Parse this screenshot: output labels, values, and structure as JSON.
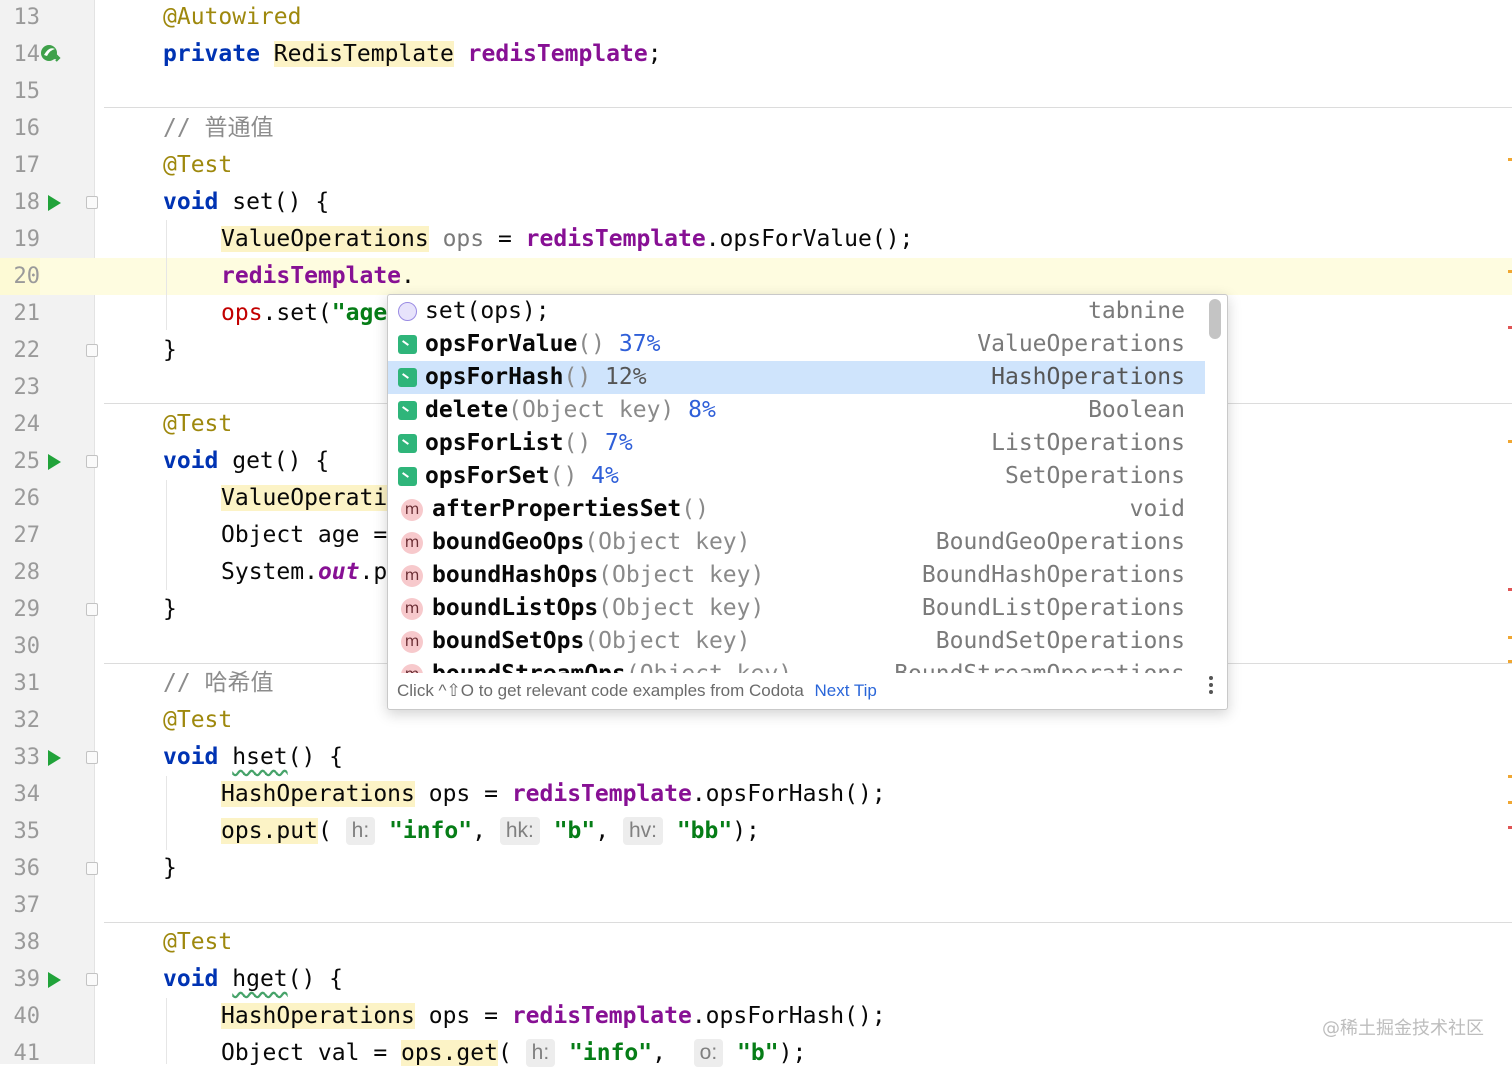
{
  "editor": {
    "lines": [
      {
        "n": "13",
        "gutter": "",
        "parts": [
          [
            "ann",
            "@Autowired"
          ]
        ]
      },
      {
        "n": "14",
        "gutter": "bean",
        "parts": [
          [
            "kw",
            "private"
          ],
          [
            "t",
            " "
          ],
          [
            "hl",
            "RedisTemplate"
          ],
          [
            "t",
            " "
          ],
          [
            "fld",
            "redisTemplate"
          ],
          [
            "t",
            ";"
          ]
        ]
      },
      {
        "n": "15",
        "gutter": "",
        "parts": []
      },
      {
        "n": "16",
        "gutter": "",
        "parts": [
          [
            "cm",
            "// 普通值"
          ]
        ]
      },
      {
        "n": "17",
        "gutter": "",
        "parts": [
          [
            "ann",
            "@Test"
          ]
        ]
      },
      {
        "n": "18",
        "gutter": "run-fold",
        "parts": [
          [
            "kw",
            "void"
          ],
          [
            "t",
            " set() {"
          ]
        ]
      },
      {
        "n": "19",
        "gutter": "",
        "indent": 1,
        "parts": [
          [
            "hl",
            "ValueOperations"
          ],
          [
            "t",
            " "
          ],
          [
            "gray",
            "ops"
          ],
          [
            "t",
            " = "
          ],
          [
            "fld",
            "redisTemplate"
          ],
          [
            "t",
            ".opsForValue();"
          ]
        ]
      },
      {
        "n": "20",
        "gutter": "",
        "indent": 1,
        "current": true,
        "parts": [
          [
            "fld",
            "redisTemplate"
          ],
          [
            "t",
            "."
          ]
        ]
      },
      {
        "n": "21",
        "gutter": "",
        "indent": 1,
        "parts": [
          [
            "red",
            "ops"
          ],
          [
            "t",
            ".set("
          ],
          [
            "str",
            "\"age"
          ]
        ]
      },
      {
        "n": "22",
        "gutter": "fold",
        "parts": [
          [
            "t",
            "}"
          ]
        ]
      },
      {
        "n": "23",
        "gutter": "",
        "parts": []
      },
      {
        "n": "24",
        "gutter": "",
        "parts": [
          [
            "ann",
            "@Test"
          ]
        ]
      },
      {
        "n": "25",
        "gutter": "run-fold",
        "parts": [
          [
            "kw",
            "void"
          ],
          [
            "t",
            " get() {"
          ]
        ]
      },
      {
        "n": "26",
        "gutter": "",
        "indent": 1,
        "parts": [
          [
            "hl",
            "ValueOperati"
          ]
        ]
      },
      {
        "n": "27",
        "gutter": "",
        "indent": 1,
        "parts": [
          [
            "t",
            "Object age ="
          ]
        ]
      },
      {
        "n": "28",
        "gutter": "",
        "indent": 1,
        "parts": [
          [
            "t",
            "System."
          ],
          [
            "static",
            "out"
          ],
          [
            "t",
            ".p"
          ]
        ]
      },
      {
        "n": "29",
        "gutter": "fold",
        "parts": [
          [
            "t",
            "}"
          ]
        ]
      },
      {
        "n": "30",
        "gutter": "",
        "parts": []
      },
      {
        "n": "31",
        "gutter": "",
        "parts": [
          [
            "cm",
            "// 哈希值"
          ]
        ]
      },
      {
        "n": "32",
        "gutter": "",
        "parts": [
          [
            "ann",
            "@Test"
          ]
        ]
      },
      {
        "n": "33",
        "gutter": "run-fold",
        "parts": [
          [
            "kw",
            "void"
          ],
          [
            "t",
            " "
          ],
          [
            "wavy",
            "hset"
          ],
          [
            "t",
            "() {"
          ]
        ]
      },
      {
        "n": "34",
        "gutter": "",
        "indent": 1,
        "parts": [
          [
            "hl",
            "HashOperations"
          ],
          [
            "t",
            " ops = "
          ],
          [
            "fld",
            "redisTemplate"
          ],
          [
            "t",
            ".opsForHash();"
          ]
        ]
      },
      {
        "n": "35",
        "gutter": "",
        "indent": 1,
        "parts": [
          [
            "hl",
            "ops.put"
          ],
          [
            "t",
            "( "
          ],
          [
            "hint",
            "h:"
          ],
          [
            "t",
            " "
          ],
          [
            "str",
            "\"info\""
          ],
          [
            "t",
            ", "
          ],
          [
            "hint",
            "hk:"
          ],
          [
            "t",
            " "
          ],
          [
            "str",
            "\"b\""
          ],
          [
            "t",
            ", "
          ],
          [
            "hint",
            "hv:"
          ],
          [
            "t",
            " "
          ],
          [
            "str",
            "\"bb\""
          ],
          [
            "t",
            ");"
          ]
        ]
      },
      {
        "n": "36",
        "gutter": "fold",
        "parts": [
          [
            "t",
            "}"
          ]
        ]
      },
      {
        "n": "37",
        "gutter": "",
        "parts": []
      },
      {
        "n": "38",
        "gutter": "",
        "parts": [
          [
            "ann",
            "@Test"
          ]
        ]
      },
      {
        "n": "39",
        "gutter": "run-fold",
        "parts": [
          [
            "kw",
            "void"
          ],
          [
            "t",
            " "
          ],
          [
            "wavy",
            "hget"
          ],
          [
            "t",
            "() {"
          ]
        ]
      },
      {
        "n": "40",
        "gutter": "",
        "indent": 1,
        "parts": [
          [
            "hl",
            "HashOperations"
          ],
          [
            "t",
            " ops = "
          ],
          [
            "fld",
            "redisTemplate"
          ],
          [
            "t",
            ".opsForHash();"
          ]
        ]
      },
      {
        "n": "41",
        "gutter": "",
        "indent": 1,
        "parts": [
          [
            "t",
            "Object val = "
          ],
          [
            "hl",
            "ops.get"
          ],
          [
            "t",
            "( "
          ],
          [
            "hint",
            "h:"
          ],
          [
            "t",
            " "
          ],
          [
            "str",
            "\"info\""
          ],
          [
            "t",
            ",  "
          ],
          [
            "hint",
            "o:"
          ],
          [
            "t",
            " "
          ],
          [
            "str",
            "\"b\""
          ],
          [
            "t",
            ");"
          ]
        ]
      }
    ]
  },
  "completion": {
    "items": [
      {
        "icon": "tabnine",
        "name": "set(ops);",
        "params": "",
        "pct": "",
        "type": "tabnine",
        "selected": false
      },
      {
        "icon": "term",
        "name": "opsForValue",
        "params": "()",
        "pct": "37%",
        "type": "ValueOperations",
        "selected": false
      },
      {
        "icon": "term",
        "name": "opsForHash",
        "params": "()",
        "pct": "12%",
        "type": "HashOperations",
        "selected": true
      },
      {
        "icon": "term",
        "name": "delete",
        "params": "(Object key)",
        "pct": "8%",
        "type": "Boolean",
        "selected": false
      },
      {
        "icon": "term",
        "name": "opsForList",
        "params": "()",
        "pct": "7%",
        "type": "ListOperations",
        "selected": false
      },
      {
        "icon": "term",
        "name": "opsForSet",
        "params": "()",
        "pct": "4%",
        "type": "SetOperations",
        "selected": false
      },
      {
        "icon": "method",
        "name": "afterPropertiesSet",
        "params": "()",
        "pct": "",
        "type": "void",
        "selected": false
      },
      {
        "icon": "method",
        "name": "boundGeoOps",
        "params": "(Object key)",
        "pct": "",
        "type": "BoundGeoOperations",
        "selected": false
      },
      {
        "icon": "method",
        "name": "boundHashOps",
        "params": "(Object key)",
        "pct": "",
        "type": "BoundHashOperations",
        "selected": false
      },
      {
        "icon": "method",
        "name": "boundListOps",
        "params": "(Object key)",
        "pct": "",
        "type": "BoundListOperations",
        "selected": false
      },
      {
        "icon": "method",
        "name": "boundSetOps",
        "params": "(Object key)",
        "pct": "",
        "type": "BoundSetOperations",
        "selected": false
      },
      {
        "icon": "method",
        "name": "boundStreamOps",
        "params": "(Object key)",
        "pct": "",
        "type": "BoundStreamOperations",
        "selected": false
      }
    ],
    "method_icon_letter": "m",
    "footer_text": "Click ^⇧O to get relevant code examples from Codota",
    "footer_link": "Next Tip"
  },
  "watermark": "@稀土掘金技术社区"
}
